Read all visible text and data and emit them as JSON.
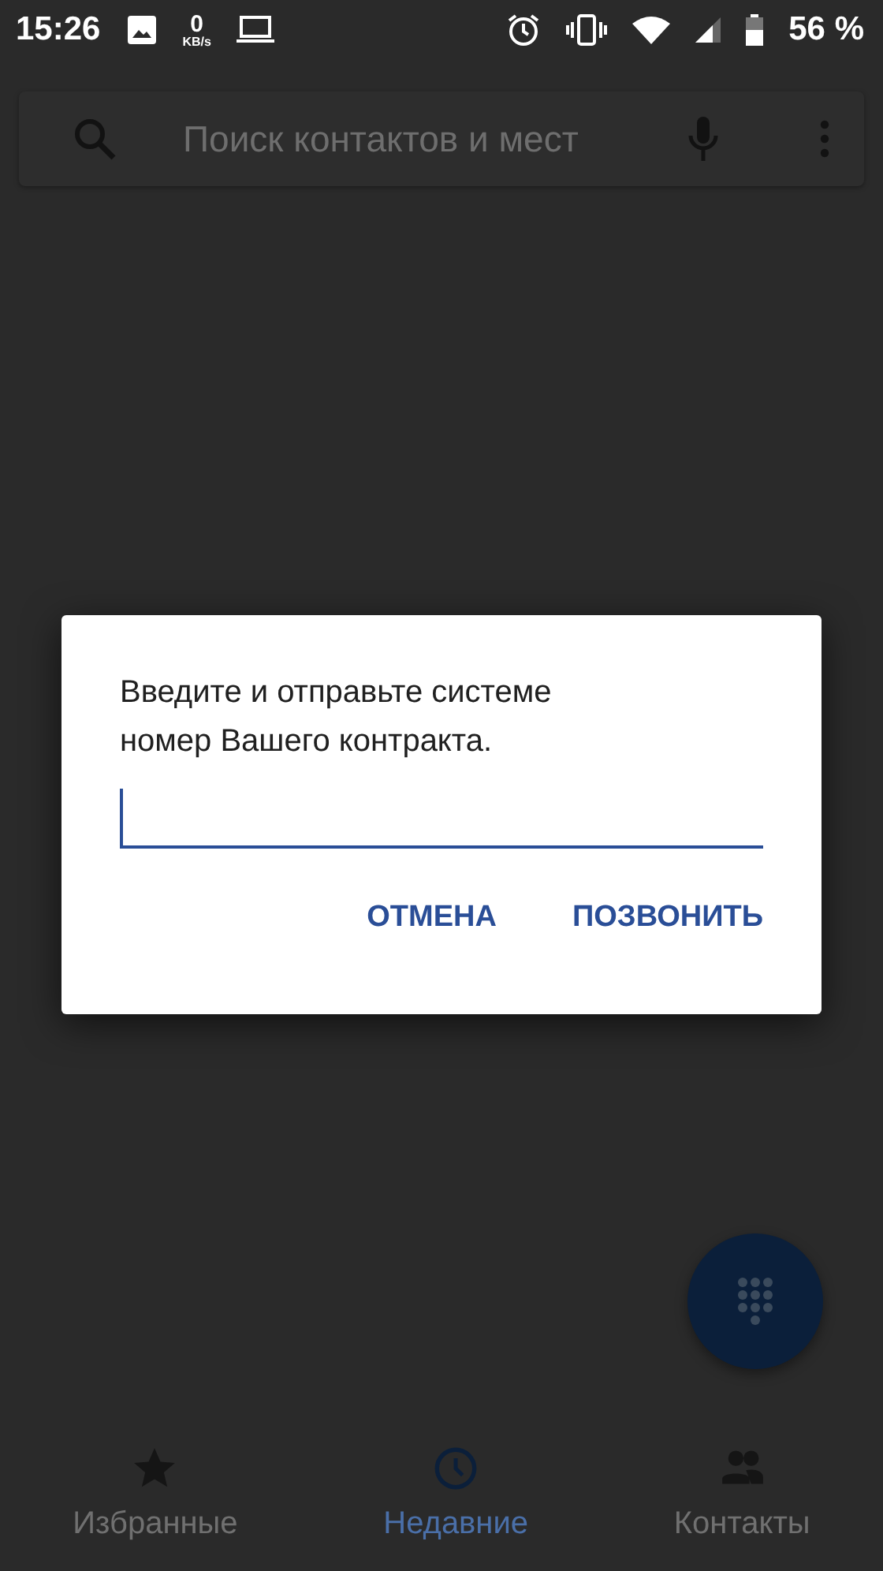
{
  "status_bar": {
    "time": "15:26",
    "net_speed_value": "0",
    "net_speed_unit": "KB/s",
    "battery": "56 %"
  },
  "search": {
    "placeholder": "Поиск контактов и мест"
  },
  "dialog": {
    "message": "Введите и отправьте системе номер Вашего контракта.",
    "field_focused": true,
    "buttons": [
      "ОТМЕНА",
      "ПОЗВОНИТЬ"
    ]
  },
  "bottom_nav": [
    {
      "label": "Избранные",
      "kind": "star",
      "selected": false
    },
    {
      "label": "Недавние",
      "kind": "clock",
      "selected": true
    },
    {
      "label": "Контакты",
      "kind": "people",
      "selected": false
    }
  ]
}
